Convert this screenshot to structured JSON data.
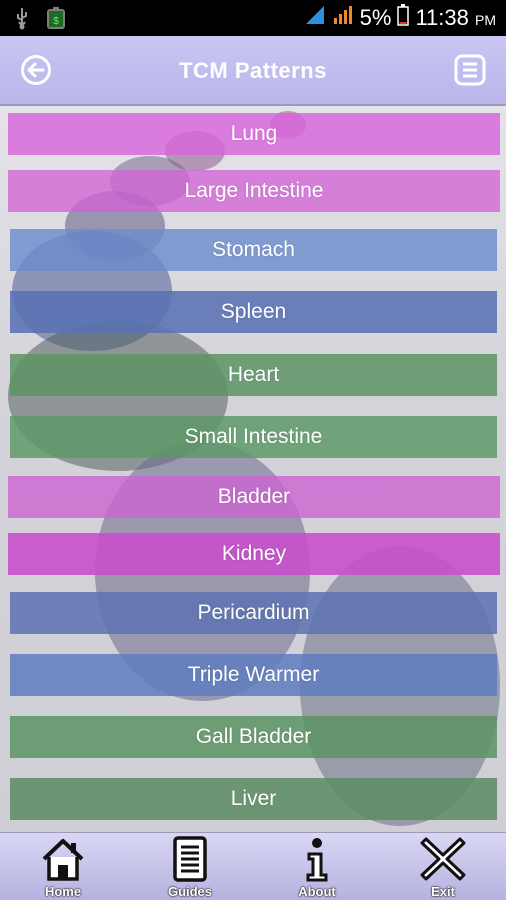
{
  "status_bar": {
    "battery_percent": "5%",
    "time": "11:38",
    "ampm": "PM",
    "icons": [
      "usb-icon",
      "battery-saver-icon",
      "signal-icon",
      "signal-icon",
      "battery-icon"
    ]
  },
  "header": {
    "title": "TCM Patterns",
    "back_icon": "back-arrow-icon",
    "menu_icon": "menu-list-icon",
    "background": "#c2bff0"
  },
  "patterns": [
    {
      "label": "Lung",
      "color": "#d864dc"
    },
    {
      "label": "Large Intestine",
      "color": "#d264d6"
    },
    {
      "label": "Stomach",
      "color": "#6c8ccc"
    },
    {
      "label": "Spleen",
      "color": "#5a72b4"
    },
    {
      "label": "Heart",
      "color": "#5d9464"
    },
    {
      "label": "Small Intestine",
      "color": "#5b9866"
    },
    {
      "label": "Bladder",
      "color": "#cc64d2"
    },
    {
      "label": "Kidney",
      "color": "#c84ccc"
    },
    {
      "label": "Pericardium",
      "color": "#5c72b2"
    },
    {
      "label": "Triple Warmer",
      "color": "#5e7cc0"
    },
    {
      "label": "Gall Bladder",
      "color": "#5c9464"
    },
    {
      "label": "Liver",
      "color": "#5a8c62"
    }
  ],
  "bottom_nav": [
    {
      "label": "Home",
      "icon": "home-icon"
    },
    {
      "label": "Guides",
      "icon": "guides-icon"
    },
    {
      "label": "About",
      "icon": "about-icon"
    },
    {
      "label": "Exit",
      "icon": "exit-icon"
    }
  ]
}
